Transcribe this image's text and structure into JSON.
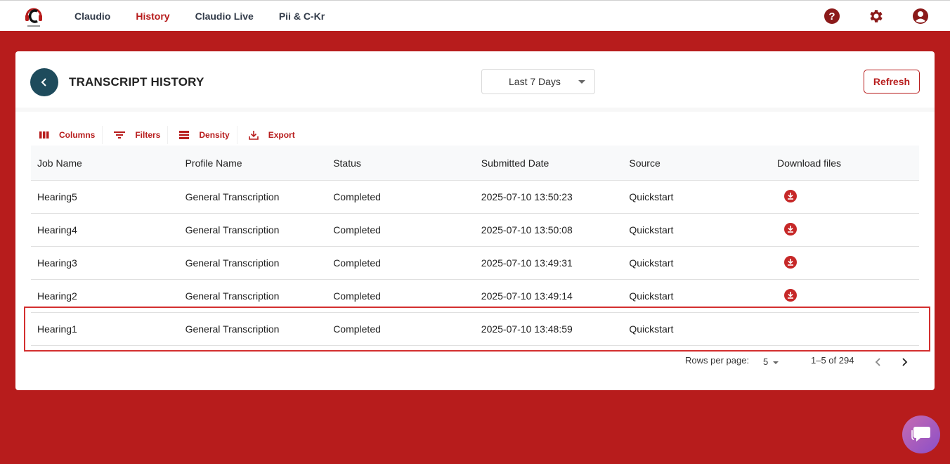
{
  "nav": {
    "items": [
      {
        "label": "Claudio",
        "active": false
      },
      {
        "label": "History",
        "active": true
      },
      {
        "label": "Claudio Live",
        "active": false
      },
      {
        "label": "Pii & C-Kr",
        "active": false
      }
    ],
    "icons": [
      "help-icon",
      "settings-icon",
      "account-icon"
    ]
  },
  "header": {
    "title": "TRANSCRIPT HISTORY",
    "date_range": "Last 7 Days",
    "refresh_label": "Refresh"
  },
  "toolbar": {
    "columns": "Columns",
    "filters": "Filters",
    "density": "Density",
    "export": "Export"
  },
  "table": {
    "columns": [
      "Job Name",
      "Profile Name",
      "Status",
      "Submitted Date",
      "Source",
      "Download files"
    ],
    "rows": [
      {
        "job": "Hearing5",
        "profile": "General Transcription",
        "status": "Completed",
        "date": "2025-07-10 13:50:23",
        "source": "Quickstart",
        "download": true
      },
      {
        "job": "Hearing4",
        "profile": "General Transcription",
        "status": "Completed",
        "date": "2025-07-10 13:50:08",
        "source": "Quickstart",
        "download": true
      },
      {
        "job": "Hearing3",
        "profile": "General Transcription",
        "status": "Completed",
        "date": "2025-07-10 13:49:31",
        "source": "Quickstart",
        "download": true
      },
      {
        "job": "Hearing2",
        "profile": "General Transcription",
        "status": "Completed",
        "date": "2025-07-10 13:49:14",
        "source": "Quickstart",
        "download": true
      },
      {
        "job": "Hearing1",
        "profile": "General Transcription",
        "status": "Completed",
        "date": "2025-07-10 13:48:59",
        "source": "Quickstart",
        "download": false
      }
    ]
  },
  "pagination": {
    "rows_per_page_label": "Rows per page:",
    "rows_per_page": "5",
    "range": "1–5 of 294"
  },
  "colors": {
    "brand": "#b71c1c",
    "back_button": "#1e4b5c",
    "highlight": "#d32f2f"
  }
}
